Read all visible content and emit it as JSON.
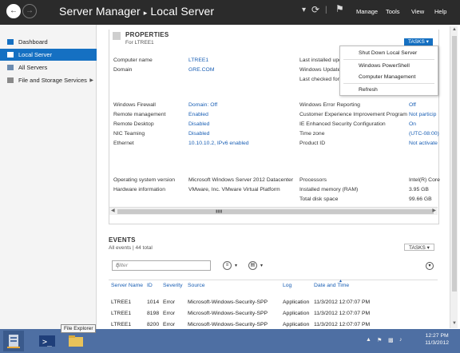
{
  "titlebar": {
    "app_title": "Server Manager",
    "separator": "▸",
    "location": "Local Server",
    "menus": [
      "Manage",
      "Tools",
      "View",
      "Help"
    ]
  },
  "sidebar": {
    "items": [
      {
        "label": "Dashboard"
      },
      {
        "label": "Local Server"
      },
      {
        "label": "All Servers"
      },
      {
        "label": "File and Storage Services"
      }
    ]
  },
  "properties": {
    "title": "PROPERTIES",
    "subtitle": "For LTREE1",
    "tasks_label": "TASKS",
    "left_group1": [
      {
        "label": "Computer name",
        "value": "LTREE1",
        "link": true
      },
      {
        "label": "Domain",
        "value": "GRE.COM",
        "link": true
      }
    ],
    "right_group1": [
      {
        "label": "Last installed upd"
      },
      {
        "label": "Windows Update"
      },
      {
        "label": "Last checked for u"
      }
    ],
    "left_group2": [
      {
        "label": "Windows Firewall",
        "value": "Domain: Off"
      },
      {
        "label": "Remote management",
        "value": "Enabled"
      },
      {
        "label": "Remote Desktop",
        "value": "Disabled"
      },
      {
        "label": "NIC Teaming",
        "value": "Disabled"
      },
      {
        "label": "Ethernet",
        "value": "10.10.10.2, IPv6 enabled"
      }
    ],
    "right_group2": [
      {
        "label": "Windows Error Reporting",
        "value": "Off"
      },
      {
        "label": "Customer Experience Improvement Program",
        "value": "Not particip"
      },
      {
        "label": "IE Enhanced Security Configuration",
        "value": "On"
      },
      {
        "label": "Time zone",
        "value": "(UTC-08:00)"
      },
      {
        "label": "Product ID",
        "value": "Not activate"
      }
    ],
    "left_group3": [
      {
        "label": "Operating system version",
        "value": "Microsoft Windows Server 2012 Datacenter"
      },
      {
        "label": "Hardware information",
        "value": "VMware, Inc. VMware Virtual Platform"
      }
    ],
    "right_group3": [
      {
        "label": "Processors",
        "value": "Intel(R) Core"
      },
      {
        "label": "Installed memory (RAM)",
        "value": "3.95 GB"
      },
      {
        "label": "Total disk space",
        "value": "99.66 GB"
      }
    ]
  },
  "tasks_menu": {
    "items": [
      "Shut Down Local Server",
      "Windows PowerShell",
      "Computer Management",
      "Refresh"
    ]
  },
  "events": {
    "title": "EVENTS",
    "subtitle": "All events | 44 total",
    "tasks_label": "TASKS",
    "filter_placeholder": "Filter",
    "columns": [
      "Server Name",
      "ID",
      "Severity",
      "Source",
      "Log",
      "Date and Time"
    ],
    "rows": [
      [
        "LTREE1",
        "1014",
        "Error",
        "Microsoft-Windows-Security-SPP",
        "Application",
        "11/3/2012 12:07:07 PM"
      ],
      [
        "LTREE1",
        "8198",
        "Error",
        "Microsoft-Windows-Security-SPP",
        "Application",
        "11/3/2012 12:07:07 PM"
      ],
      [
        "LTREE1",
        "8200",
        "Error",
        "Microsoft-Windows-Security-SPP",
        "Application",
        "11/3/2012 12:07:07 PM"
      ]
    ]
  },
  "taskbar": {
    "tooltip": "File Explorer",
    "time": "12:27 PM",
    "date": "11/3/2012"
  },
  "colors": {
    "titlebar": "#2b2b2b",
    "accent": "#1570c2",
    "link": "#1a5fb4",
    "taskbar": "#4e6fa3"
  },
  "icons": {
    "back": "back-arrow-icon",
    "forward": "forward-arrow-icon",
    "refresh": "refresh-icon",
    "flag": "notifications-flag-icon"
  }
}
